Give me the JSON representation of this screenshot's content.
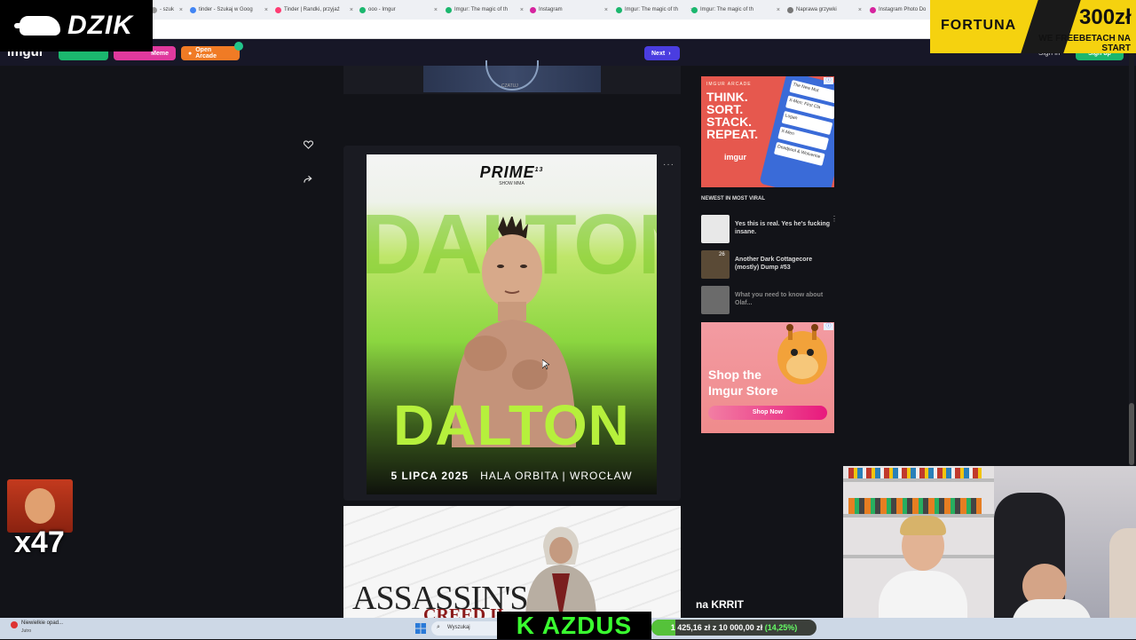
{
  "browser": {
    "tabs": [
      {
        "label": "- szuk",
        "color": "#999"
      },
      {
        "label": "tinder - Szukaj w Goog",
        "color": "#4285f4"
      },
      {
        "label": "Tinder | Randki, przyjaź",
        "color": "#fe3c72"
      },
      {
        "label": "ooo - Imgur",
        "color": "#1bb76e"
      },
      {
        "label": "Imgur: The magic of th",
        "color": "#1bb76e"
      },
      {
        "label": "Instagram",
        "color": "#d6249f"
      },
      {
        "label": "Imgur: The magic of th",
        "color": "#1bb76e"
      },
      {
        "label": "Imgur: The magic of th",
        "color": "#1bb76e"
      },
      {
        "label": "Naprawa grzywki",
        "color": "#777"
      },
      {
        "label": "Instagram Photo Do",
        "color": "#d6249f"
      }
    ]
  },
  "imgur_header": {
    "logo": "imgur",
    "meme_label": "Meme",
    "arcade_label": "Open Arcade",
    "next_label": "Next",
    "signin_label": "Sign in",
    "signup_label": "Sign up"
  },
  "overlays": {
    "dzik_brand": "DZIK",
    "fortuna_name": "FORTUNA",
    "fortuna_amount": "300zł",
    "fortuna_tagline": "WE FREEBETACH NA START",
    "multiplier": "x47"
  },
  "post_prev": {
    "watermark": "CZATUJ"
  },
  "poster": {
    "org": "PRIME",
    "org_number": "13",
    "org_sub": "SHOW MMA",
    "bg_text": "DALTON",
    "fighter": "DALTON",
    "date": "5 LIPCA 2025",
    "venue": "HALA ORBITA | WROCŁAW"
  },
  "post_next": {
    "title_line1": "ASSASSIN'S",
    "title_line2": "CREED II"
  },
  "sidebar": {
    "ad1": {
      "brand": "IMGUR ARCADE",
      "headline": [
        "THINK.",
        "SORT.",
        "STACK.",
        "REPEAT."
      ],
      "logo": "imgur",
      "cards": [
        "The New Mut",
        "X-Men: First Cla",
        "Logan",
        "X-Men",
        "Deadpool & Wolverine"
      ]
    },
    "section_title": "NEWEST IN MOST VIRAL",
    "viral": [
      {
        "title": "Yes this is real. Yes he's fucking insane.",
        "color": "#e8e8e8"
      },
      {
        "title": "Another Dark Cottagecore (mostly) Dump #53",
        "color": "#5a4a36",
        "badge": "26"
      },
      {
        "title": "What you need to know about Olaf...",
        "color": "#6b6b6b"
      }
    ],
    "ad2": {
      "headline": "Shop the Imgur Store",
      "button": "Shop Now"
    }
  },
  "stream": {
    "caption": "na KRRIT",
    "nick": "K AZDUS",
    "goal": "1 425,16 zł z 10 000,00 zł",
    "goal_pct": "(14,25%)",
    "goal_fraction": 0.1425
  },
  "taskbar": {
    "weather": "Niewielkie opad...",
    "weather_sub": "Jutro",
    "search": "Wyszukaj"
  }
}
